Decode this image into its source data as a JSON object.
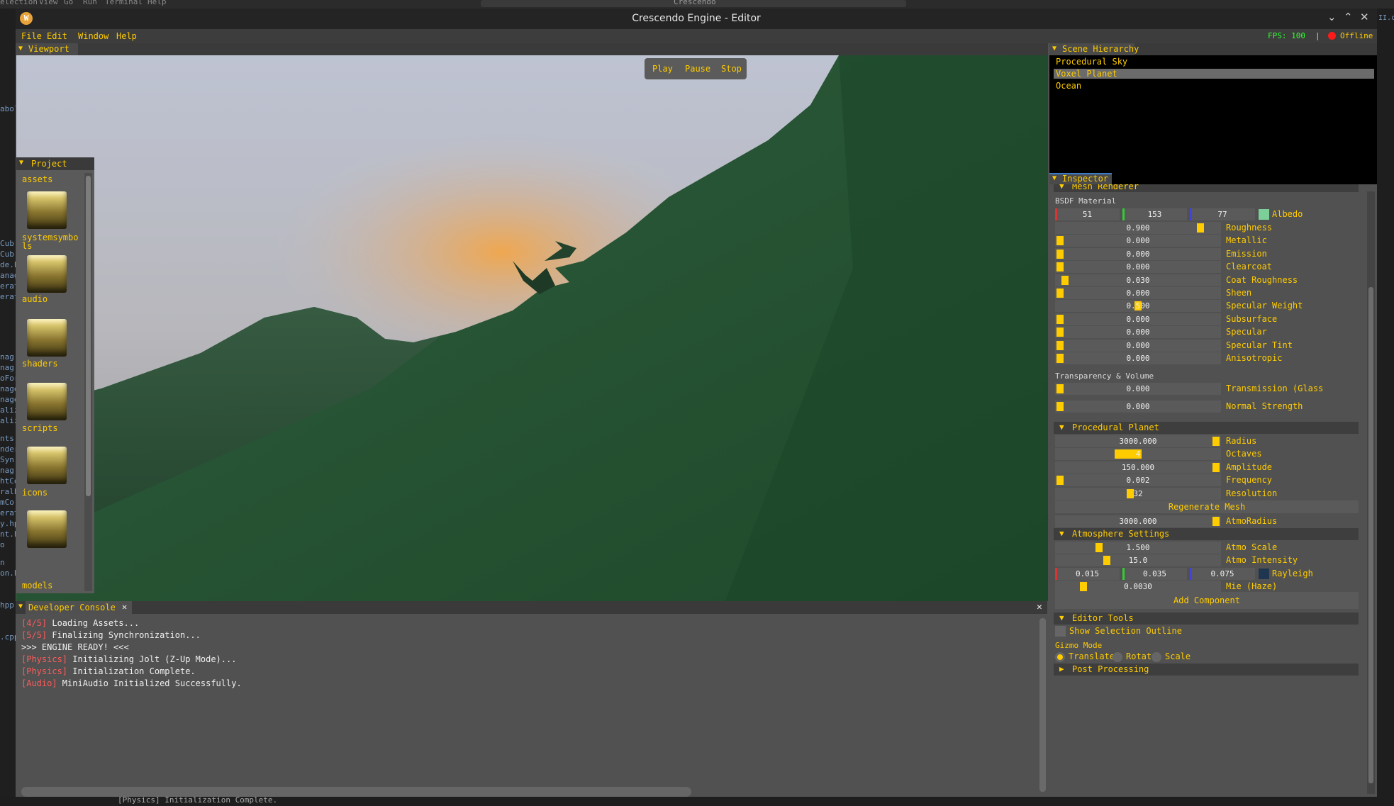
{
  "host": {
    "menu": [
      "election",
      "View",
      "Go",
      "Run",
      "Terminal",
      "Help"
    ],
    "search_text": "Crescendo",
    "sidebar_fragments": [
      "abols",
      "Cub",
      "Cub",
      "de.h",
      "anag",
      "erat",
      "erat",
      "nag",
      "nag",
      "oFor",
      "nage",
      "nage",
      "aliz",
      "aliz",
      "nts",
      "nder",
      "Syn",
      "nag",
      "htCo",
      "ralP",
      "mCo",
      "erat",
      "y.hp",
      "nt.h",
      "o",
      "n",
      "on.h",
      "hpp",
      ".cpp"
    ],
    "right_fragment": "II.cp",
    "bottom_text": "[Physics] Initialization Complete."
  },
  "window": {
    "title": "Crescendo Engine - Editor",
    "logo": "W",
    "controls": [
      "⌄",
      "⌃",
      "✕"
    ]
  },
  "menubar": {
    "items": [
      "File",
      "Edit",
      "Window",
      "Help"
    ],
    "fps": "FPS: 100",
    "separator": "|",
    "status": "Offline"
  },
  "viewport": {
    "title": "Viewport",
    "play": "Play",
    "pause": "Pause",
    "stop": "Stop"
  },
  "project": {
    "title": "Project",
    "root": "assets",
    "folders": [
      "systemsymbols",
      "audio",
      "shaders",
      "scripts",
      "icons",
      "models"
    ]
  },
  "console": {
    "title": "Developer Console",
    "close": "✕",
    "panel_close": "✕",
    "lines": [
      {
        "tag": "[4/5]",
        "text": " Loading Assets..."
      },
      {
        "tag": "[5/5]",
        "text": " Finalizing Synchronization..."
      },
      {
        "tag": "",
        "text": ">>> ENGINE READY! <<<"
      },
      {
        "tag": "[Physics]",
        "text": " Initializing Jolt (Z-Up Mode)..."
      },
      {
        "tag": "[Physics]",
        "text": " Initialization Complete."
      },
      {
        "tag": "[Audio]",
        "text": " MiniAudio Initialized Successfully."
      }
    ]
  },
  "hierarchy": {
    "title": "Scene Hierarchy",
    "items": [
      "Procedural Sky",
      "Voxel Planet",
      "Ocean"
    ],
    "selected": "Voxel Planet"
  },
  "inspector": {
    "title": "Inspector",
    "mesh_renderer": "Mesh Renderer",
    "bsdf": "BSDF Material",
    "albedo": {
      "r": "51",
      "g": "153",
      "b": "77",
      "label": "Albedo",
      "color": "#33994d"
    },
    "material": [
      {
        "label": "Roughness",
        "value": "0.900",
        "t": 0.9
      },
      {
        "label": "Metallic",
        "value": "0.000",
        "t": 0.0
      },
      {
        "label": "Emission",
        "value": "0.000",
        "t": 0.0
      },
      {
        "label": "Clearcoat",
        "value": "0.000",
        "t": 0.0
      },
      {
        "label": "Coat Roughness",
        "value": "0.030",
        "t": 0.03
      },
      {
        "label": "Sheen",
        "value": "0.000",
        "t": 0.0
      },
      {
        "label": "Specular Weight",
        "value": "0.500",
        "t": 0.5
      },
      {
        "label": "Subsurface",
        "value": "0.000",
        "t": 0.0
      },
      {
        "label": "Specular",
        "value": "0.000",
        "t": 0.0
      },
      {
        "label": "Specular Tint",
        "value": "0.000",
        "t": 0.0
      },
      {
        "label": "Anisotropic",
        "value": "0.000",
        "t": 0.0
      }
    ],
    "transparency_title": "Transparency & Volume",
    "transparency": [
      {
        "label": "Transmission (Glass",
        "value": "0.000",
        "t": 0.0
      },
      {
        "label": "Normal Strength",
        "value": "0.000",
        "t": 0.0
      }
    ],
    "planet_title": "Procedural Planet",
    "planet": [
      {
        "label": "Radius",
        "value": "3000.000",
        "t": 1.0
      },
      {
        "label": "Octaves",
        "value": "4",
        "t": 0.43
      },
      {
        "label": "Amplitude",
        "value": "150.000",
        "t": 1.0
      },
      {
        "label": "Frequency",
        "value": "0.002",
        "t": 0.0
      },
      {
        "label": "Resolution",
        "value": "32",
        "t": 0.45
      }
    ],
    "regenerate": "Regenerate Mesh",
    "atmo_radius": {
      "label": "AtmoRadius",
      "value": "3000.000",
      "t": 1.0
    },
    "atmosphere_title": "Atmosphere Settings",
    "atmosphere": [
      {
        "label": "Atmo Scale",
        "value": "1.500",
        "t": 0.25
      },
      {
        "label": "Atmo Intensity",
        "value": "15.0",
        "t": 0.3
      }
    ],
    "rayleigh": {
      "r": "0.015",
      "g": "0.035",
      "b": "0.075",
      "label": "Rayleigh",
      "color": "#1f3550"
    },
    "mie": {
      "label": "Mie (Haze)",
      "value": "0.0030",
      "t": 0.15
    },
    "add_component": "Add Component",
    "editor_tools_title": "Editor Tools",
    "show_outline": "Show Selection Outline",
    "gizmo_title": "Gizmo Mode",
    "gizmo_modes": [
      "Translate",
      "Rotate",
      "Scale"
    ],
    "gizmo_selected": "Translate",
    "post_processing": "Post Processing"
  },
  "colors": {
    "accent": "#ffcc00",
    "log_tag": "#ff5a5a",
    "fps": "#33ff33",
    "status_dot": "#ff1a1a"
  }
}
